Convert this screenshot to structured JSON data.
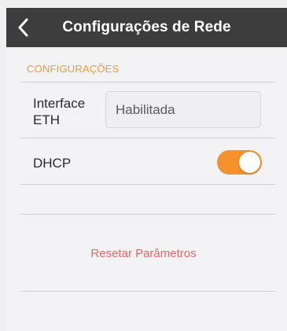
{
  "navbar": {
    "title": "Configurações de Rede",
    "back_icon": "chevron-left-icon"
  },
  "section": {
    "header": "CONFIGURAÇÕES"
  },
  "interface_eth": {
    "label_line1": "Interface",
    "label_line2": "ETH",
    "value": "Habilitada"
  },
  "dhcp": {
    "label": "DHCP",
    "enabled": true
  },
  "actions": {
    "reset_label": "Resetar Parâmetros"
  },
  "colors": {
    "navbar_bg": "#3d3d3d",
    "accent": "#f5922e",
    "section_header": "#f39c36",
    "reset_text": "#e26a6a"
  }
}
